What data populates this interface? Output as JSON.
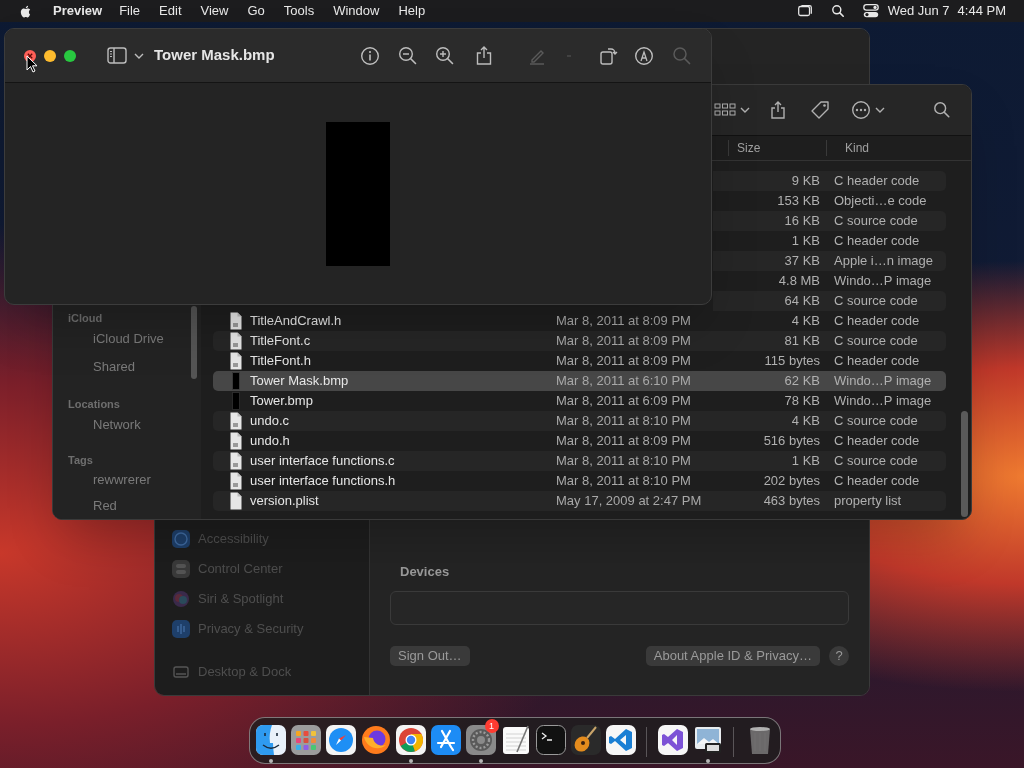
{
  "menu_bar": {
    "app_name": "Preview",
    "menus": [
      "File",
      "Edit",
      "View",
      "Go",
      "Tools",
      "Window",
      "Help"
    ],
    "date": "Wed Jun 7",
    "time": "4:44 PM"
  },
  "settings_window": {
    "sidebar": [
      {
        "label": "Accessibility",
        "kind": "accessibility"
      },
      {
        "label": "Control Center",
        "kind": "control"
      },
      {
        "label": "Siri & Spotlight",
        "kind": "siri"
      },
      {
        "label": "Privacy & Security",
        "kind": "privacy"
      },
      {
        "label": "Desktop & Dock",
        "kind": "desktop"
      }
    ],
    "devices_heading": "Devices",
    "sign_out_button": "Sign Out…",
    "about_button": "About Apple ID & Privacy…",
    "help_button": "?"
  },
  "finder_window": {
    "sidebar": [
      {
        "heading": "iCloud",
        "items": [
          "iCloud Drive",
          "Shared"
        ]
      },
      {
        "heading": "Locations",
        "items": [
          "Network"
        ]
      },
      {
        "heading": "Tags",
        "items": [
          "rewwrerer",
          "Red"
        ]
      }
    ],
    "columns": [
      "Size",
      "Kind"
    ],
    "rows": [
      {
        "size": "9 KB",
        "kind_label": "C header code",
        "selected": false
      },
      {
        "size": "153 KB",
        "kind_label": "Objecti…e code",
        "selected": false
      },
      {
        "size": "16 KB",
        "kind_label": "C source code",
        "selected": false
      },
      {
        "size": "1 KB",
        "kind_label": "C header code",
        "selected": false
      },
      {
        "size": "37 KB",
        "kind_label": "Apple i…n image",
        "selected": false
      },
      {
        "size": "4.8 MB",
        "kind_label": "Windo…P image",
        "selected": false
      },
      {
        "size": "64 KB",
        "kind_label": "C source code",
        "selected": false
      },
      {
        "name": "TitleAndCrawl.h",
        "date": "Mar 8, 2011 at 8:09 PM",
        "size": "4 KB",
        "kind_label": "C header code",
        "kind": "h",
        "selected": false
      },
      {
        "name": "TitleFont.c",
        "date": "Mar 8, 2011 at 8:09 PM",
        "size": "81 KB",
        "kind_label": "C source code",
        "kind": "c",
        "selected": false
      },
      {
        "name": "TitleFont.h",
        "date": "Mar 8, 2011 at 8:09 PM",
        "size": "115 bytes",
        "kind_label": "C header code",
        "kind": "h",
        "selected": false
      },
      {
        "name": "Tower Mask.bmp",
        "date": "Mar 8, 2011 at 6:10 PM",
        "size": "62 KB",
        "kind_label": "Windo…P image",
        "kind": "image",
        "selected": true
      },
      {
        "name": "Tower.bmp",
        "date": "Mar 8, 2011 at 6:09 PM",
        "size": "78 KB",
        "kind_label": "Windo…P image",
        "kind": "image",
        "selected": false
      },
      {
        "name": "undo.c",
        "date": "Mar 8, 2011 at 8:10 PM",
        "size": "4 KB",
        "kind_label": "C source code",
        "kind": "c",
        "selected": false
      },
      {
        "name": "undo.h",
        "date": "Mar 8, 2011 at 8:09 PM",
        "size": "516 bytes",
        "kind_label": "C header code",
        "kind": "h",
        "selected": false
      },
      {
        "name": "user interface functions.c",
        "date": "Mar 8, 2011 at 8:10 PM",
        "size": "1 KB",
        "kind_label": "C source code",
        "kind": "c",
        "selected": false
      },
      {
        "name": "user interface functions.h",
        "date": "Mar 8, 2011 at 8:10 PM",
        "size": "202 bytes",
        "kind_label": "C header code",
        "kind": "h",
        "selected": false
      },
      {
        "name": "version.plist",
        "date": "May 17, 2009 at 2:47 PM",
        "size": "463 bytes",
        "kind_label": "property list",
        "kind": "plist",
        "selected": false
      }
    ]
  },
  "preview_window": {
    "title": "Tower Mask.bmp"
  },
  "dock": {
    "items": [
      {
        "kind": "finder",
        "running": true
      },
      {
        "kind": "launchpad",
        "running": false
      },
      {
        "kind": "safari",
        "running": false
      },
      {
        "kind": "firefox",
        "running": false
      },
      {
        "kind": "chrome",
        "running": true
      },
      {
        "kind": "appstore",
        "running": false
      },
      {
        "kind": "settings",
        "running": true,
        "badge": "1"
      },
      {
        "kind": "textedit",
        "running": false
      },
      {
        "kind": "terminal",
        "running": false
      },
      {
        "kind": "garageband",
        "running": false
      },
      {
        "kind": "vscode",
        "running": false
      },
      {
        "kind": "separator"
      },
      {
        "kind": "visualstudio",
        "running": false
      },
      {
        "kind": "preview",
        "running": true
      },
      {
        "kind": "separator"
      },
      {
        "kind": "trash",
        "running": false
      }
    ]
  }
}
